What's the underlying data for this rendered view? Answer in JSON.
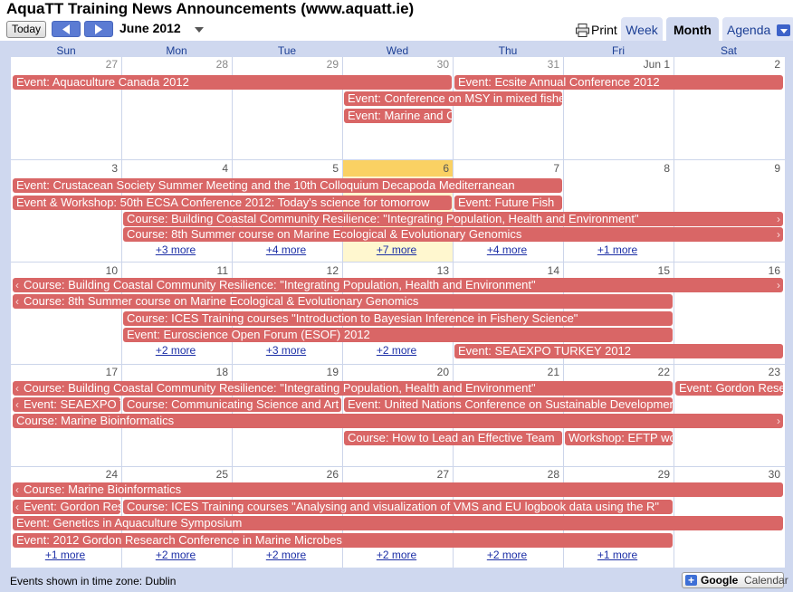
{
  "header": {
    "title": "AquaTT Training News Announcements (www.aquatt.ie)",
    "today_label": "Today",
    "month_label": "June 2012",
    "print_label": "Print",
    "tabs": {
      "week": "Week",
      "month": "Month",
      "agenda": "Agenda"
    }
  },
  "weekdays": [
    "Sun",
    "Mon",
    "Tue",
    "Wed",
    "Thu",
    "Fri",
    "Sat"
  ],
  "weeks": [
    {
      "days": [
        "27",
        "28",
        "29",
        "30",
        "31",
        "Jun 1",
        "2"
      ],
      "events": [
        {
          "text": "Event: Aquaculture Canada 2012"
        },
        {
          "text": "Event: Ecsite Annual Conference 2012"
        },
        {
          "text": "Event: Conference on MSY in mixed fisheries"
        },
        {
          "text": "Event: Marine and Coastal"
        }
      ],
      "more": []
    },
    {
      "days": [
        "3",
        "4",
        "5",
        "6",
        "7",
        "8",
        "9"
      ],
      "events": [
        {
          "text": "Event: Crustacean Society Summer Meeting and the 10th Colloquium Decapoda Mediterranean"
        },
        {
          "text": "Event & Workshop: 50th ECSA Conference 2012: Today's science for tomorrow"
        },
        {
          "text": "Event: Future Fish"
        },
        {
          "text": "Course: Building Coastal Community Resilience: \"Integrating Population, Health and Environment\""
        },
        {
          "text": "Course: 8th Summer course on Marine Ecological & Evolutionary Genomics"
        }
      ],
      "more": [
        "+3 more",
        "+4 more",
        "+7 more",
        "+4 more",
        "+1 more"
      ]
    },
    {
      "days": [
        "10",
        "11",
        "12",
        "13",
        "14",
        "15",
        "16"
      ],
      "events": [
        {
          "text": "Course: Building Coastal Community Resilience: \"Integrating Population, Health and Environment\""
        },
        {
          "text": "Course: 8th Summer course on Marine Ecological & Evolutionary Genomics"
        },
        {
          "text": "Course: ICES Training courses \"Introduction to Bayesian Inference in Fishery Science\""
        },
        {
          "text": "Event: Euroscience Open Forum (ESOF) 2012"
        },
        {
          "text": "Event: SEAEXPO TURKEY 2012"
        }
      ],
      "more": [
        "+2 more",
        "+3 more",
        "+2 more"
      ]
    },
    {
      "days": [
        "17",
        "18",
        "19",
        "20",
        "21",
        "22",
        "23"
      ],
      "events": [
        {
          "text": "Course: Building Coastal Community Resilience: \"Integrating Population, Health and Environment\""
        },
        {
          "text": "Event: Gordon Research"
        },
        {
          "text": "Event: SEAEXPO TURKEY"
        },
        {
          "text": "Course: Communicating Science and Art"
        },
        {
          "text": "Event: United Nations Conference on Sustainable Development"
        },
        {
          "text": "Course: Marine Bioinformatics"
        },
        {
          "text": "Course: How to Lead an Effective Team"
        },
        {
          "text": "Workshop: EFTP workshop"
        }
      ],
      "more": []
    },
    {
      "days": [
        "24",
        "25",
        "26",
        "27",
        "28",
        "29",
        "30"
      ],
      "events": [
        {
          "text": "Course: Marine Bioinformatics"
        },
        {
          "text": "Event: Gordon Research"
        },
        {
          "text": "Course: ICES Training courses \"Analysing and visualization of VMS and EU logbook data using the R\""
        },
        {
          "text": "Event: Genetics in Aquaculture Symposium"
        },
        {
          "text": "Event: 2012 Gordon Research Conference in Marine Microbes"
        }
      ],
      "more": [
        "+1 more",
        "+2 more",
        "+2 more",
        "+2 more",
        "+2 more",
        "+1 more"
      ]
    }
  ],
  "footer": {
    "timezone": "Events shown in time zone: Dublin",
    "gcal_plus": "+",
    "gcal_brand": "Google",
    "gcal_product": "Calendar"
  },
  "colors": {
    "event": "#d96666",
    "today": "#fad163",
    "frame": "#cfd8ef",
    "link": "#1c2fa6"
  }
}
